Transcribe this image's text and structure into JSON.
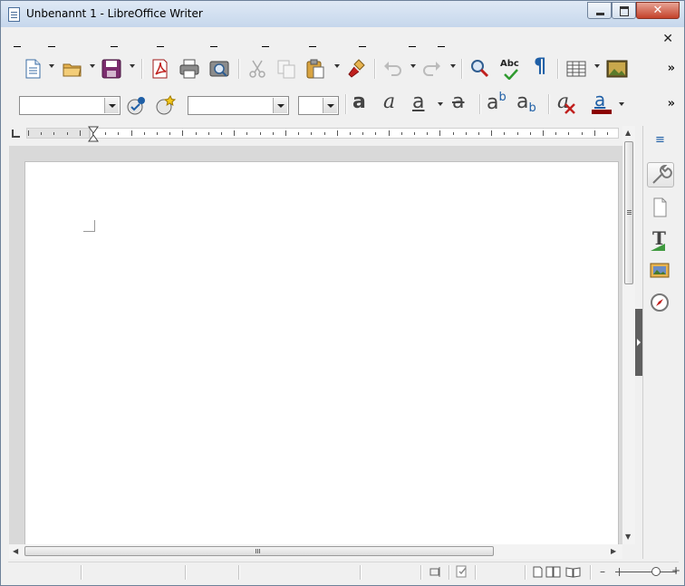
{
  "window": {
    "title": "Unbenannt 1 - LibreOffice Writer",
    "close_glyph": "✕"
  },
  "menubar": {
    "close_doc_glyph": "✕"
  },
  "toolbar_standard": {
    "icons": [
      "new-document-icon",
      "open-folder-icon",
      "save-icon",
      "export-pdf-icon",
      "print-icon",
      "print-preview-icon",
      "cut-icon",
      "copy-icon",
      "paste-icon",
      "clone-formatting-icon",
      "undo-icon",
      "redo-icon",
      "find-replace-icon",
      "spellcheck-icon",
      "formatting-marks-icon",
      "table-icon",
      "insert-image-icon"
    ],
    "spellcheck_label": "Abc",
    "pilcrow": "¶",
    "overflow_glyph": "»"
  },
  "toolbar_formatting": {
    "paragraph_style": "",
    "font_name": "",
    "font_size": "",
    "bold_glyph": "a",
    "italic_glyph": "a",
    "underline_glyph": "a",
    "strike_glyph": "a",
    "superscript_glyph": "a",
    "superscript_mark": "b",
    "subscript_glyph": "a",
    "subscript_mark": "b",
    "clear_glyph": "a",
    "font_color_glyph": "a",
    "font_color": "#8b0000",
    "overflow_glyph": "»"
  },
  "sidebar": {
    "menu_glyph": "≡",
    "icons": [
      "properties-icon",
      "page-icon",
      "styles-icon",
      "gallery-icon",
      "navigator-icon"
    ],
    "styles_glyph": "T"
  },
  "colors": {
    "accent": "#1f5fa6",
    "font_color_bar": "#8b0000"
  }
}
